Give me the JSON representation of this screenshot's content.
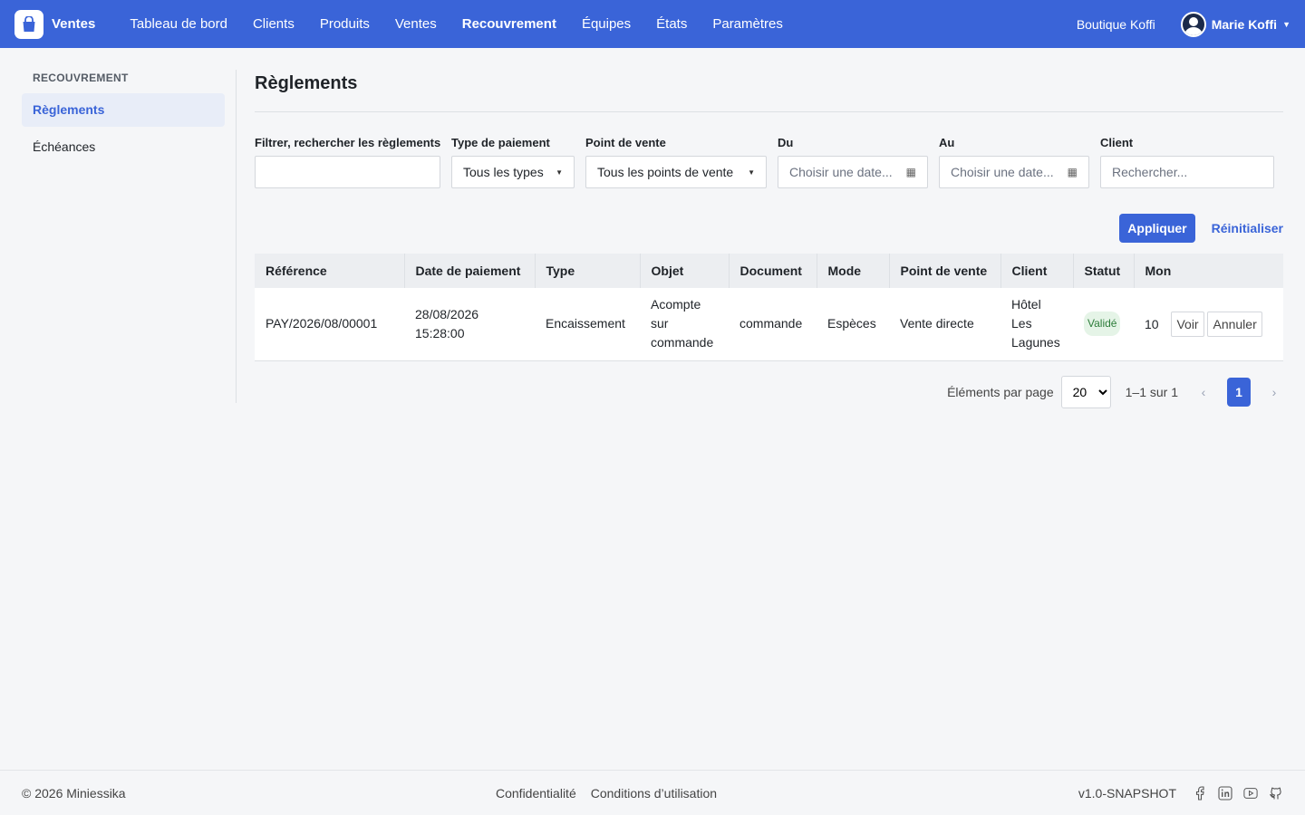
{
  "navbar": {
    "brand": "Ventes",
    "links": [
      "Tableau de bord",
      "Clients",
      "Produits",
      "Ventes",
      "Recouvrement",
      "Équipes",
      "États",
      "Paramètres"
    ],
    "active_link": "Recouvrement",
    "shop": "Boutique Koffi",
    "user": "Marie Koffi",
    "accent": "#3a64d8"
  },
  "sidebar": {
    "heading": "RECOUVREMENT",
    "items": [
      {
        "label": "Règlements",
        "active": true
      },
      {
        "label": "Échéances",
        "active": false
      }
    ]
  },
  "page": {
    "title": "Règlements"
  },
  "filters": {
    "search": {
      "label": "Filtrer, rechercher les règlements",
      "value": ""
    },
    "type": {
      "label": "Type de paiement",
      "value": "Tous les types"
    },
    "pos": {
      "label": "Point de vente",
      "value": "Tous les points de vente"
    },
    "from": {
      "label": "Du",
      "placeholder": "Choisir une date..."
    },
    "to": {
      "label": "Au",
      "placeholder": "Choisir une date..."
    },
    "client": {
      "label": "Client",
      "placeholder": "Rechercher..."
    }
  },
  "actions": {
    "apply": "Appliquer",
    "reset": "Réinitialiser"
  },
  "table": {
    "columns": [
      "Référence",
      "Date de paiement",
      "Type",
      "Objet",
      "Document",
      "Mode",
      "Point de vente",
      "Client",
      "Statut",
      "Mon"
    ],
    "rows": [
      {
        "reference": "PAY/2026/08/00001",
        "date": "28/08/2026",
        "time": "15:28:00",
        "type": "Encaissement",
        "objet": "Acompte sur commande",
        "document": "commande",
        "mode": "Espèces",
        "pos": "Vente directe",
        "client": "Hôtel Les Lagunes",
        "status": "Validé",
        "amount": "10",
        "view": "Voir",
        "cancel": "Annuler"
      }
    ]
  },
  "pagination": {
    "per_page_label": "Éléments par page",
    "per_page": "20",
    "range": "1–1 sur 1",
    "current": "1",
    "prev": "‹",
    "next": "›"
  },
  "footer": {
    "copyright": "© 2026 Miniessika",
    "links": [
      "Confidentialité",
      "Conditions d’utilisation"
    ],
    "version": "v1.0-SNAPSHOT",
    "socials": [
      "facebook-icon",
      "linkedin-icon",
      "youtube-icon",
      "github-icon"
    ]
  }
}
